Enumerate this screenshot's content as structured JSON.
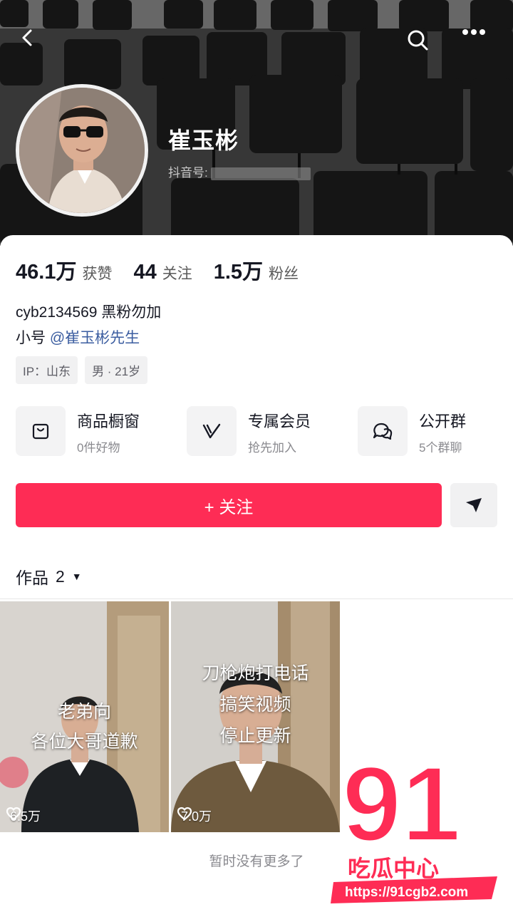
{
  "header": {
    "name": "崔玉彬",
    "douyin_id_label": "抖音号:"
  },
  "stats": [
    {
      "value": "46.1万",
      "label": "获赞"
    },
    {
      "value": "44",
      "label": "关注"
    },
    {
      "value": "1.5万",
      "label": "粉丝"
    }
  ],
  "bio": {
    "line1": "cyb2134569 黑粉勿加",
    "line2_prefix": "小号 ",
    "line2_mention": "@崔玉彬先生"
  },
  "tags": [
    "IP：山东",
    "男 · 21岁"
  ],
  "features": [
    {
      "title": "商品橱窗",
      "sub": "0件好物",
      "icon": "shop-bag-icon"
    },
    {
      "title": "专属会员",
      "sub": "抢先加入",
      "icon": "member-v-icon"
    },
    {
      "title": "公开群",
      "sub": "5个群聊",
      "icon": "group-chat-icon"
    }
  ],
  "follow_label": "+ 关注",
  "works": {
    "label": "作品",
    "count": "2",
    "caret": "▼"
  },
  "videos": [
    {
      "caption": [
        "老弟向",
        "各位大哥道歉"
      ],
      "likes": "6.5万"
    },
    {
      "caption": [
        "刀枪炮打电话",
        "搞笑视频",
        "停止更新"
      ],
      "likes": "7.0万"
    }
  ],
  "no_more": "暂时没有更多了",
  "watermark": {
    "number": "91",
    "text": "吃瓜中心",
    "url": "https://91cgb2.com"
  },
  "colors": {
    "accent": "#fe2c55",
    "mention": "#3b5da0"
  }
}
